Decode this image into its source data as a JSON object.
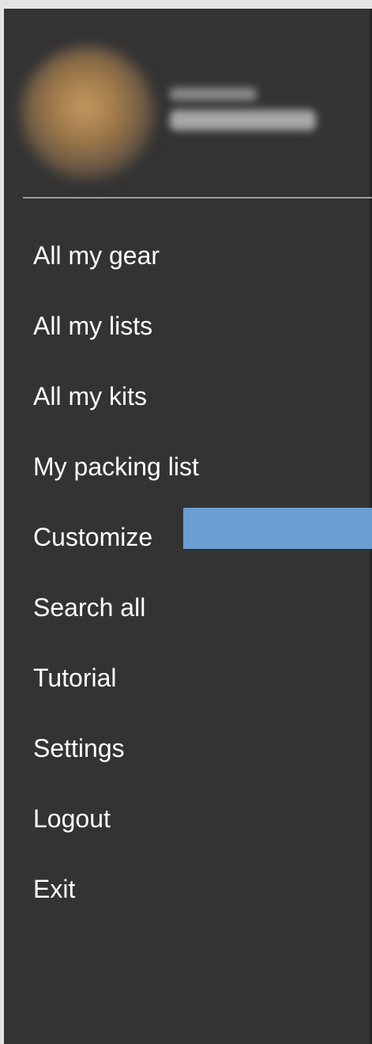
{
  "profile": {
    "name": "",
    "email": ""
  },
  "menu": [
    {
      "label": "All my gear"
    },
    {
      "label": "All my lists"
    },
    {
      "label": "All my kits"
    },
    {
      "label": "My packing list"
    },
    {
      "label": "Customize"
    },
    {
      "label": "Search all"
    },
    {
      "label": "Tutorial"
    },
    {
      "label": "Settings"
    },
    {
      "label": "Logout"
    },
    {
      "label": "Exit"
    }
  ],
  "colors": {
    "drawer_background": "#333333",
    "text": "#ffffff",
    "divider": "#9d9d9d",
    "highlight": "#6b9ed4"
  }
}
